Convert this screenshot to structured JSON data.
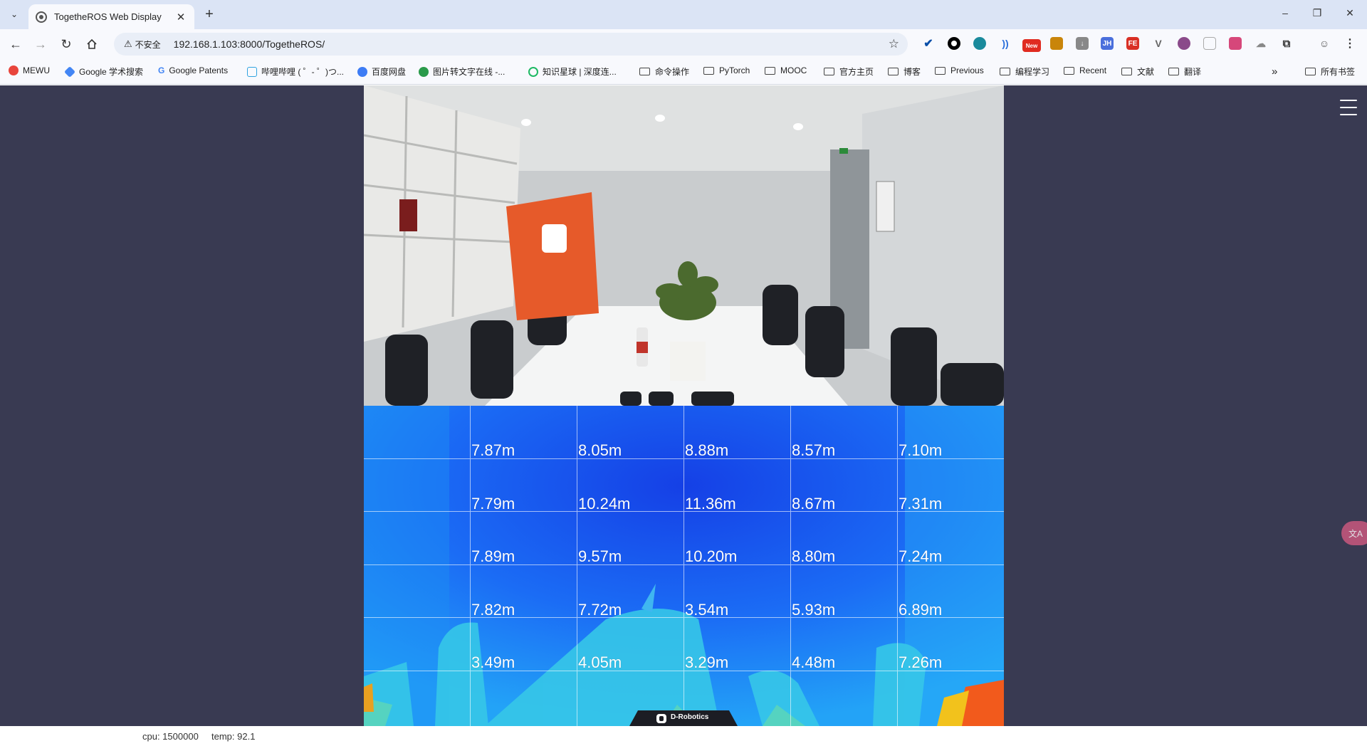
{
  "browser": {
    "tab_title": "TogetheROS Web Display",
    "security_label": "不安全",
    "url": "192.168.1.103:8000/TogetheROS/",
    "new_badge": "New",
    "ext_jh": "JH",
    "ext_fe": "FE"
  },
  "bookmarks": [
    {
      "label": "MEWU",
      "icon": "mewu-icon"
    },
    {
      "label": "Google 学术搜索",
      "icon": "scholar-icon"
    },
    {
      "label": "Google Patents",
      "icon": "google-icon"
    },
    {
      "label": "哔哩哔哩 ( ゜- ゜)つ...",
      "icon": "bilibili-icon"
    },
    {
      "label": "百度网盘",
      "icon": "baidu-icon"
    },
    {
      "label": "图片转文字在线 -...",
      "icon": "ocr-icon"
    },
    {
      "label": "知识星球 | 深度连...",
      "icon": "zsxq-icon"
    },
    {
      "label": "命令操作",
      "icon": "folder-icon"
    },
    {
      "label": "PyTorch",
      "icon": "folder-icon"
    },
    {
      "label": "MOOC",
      "icon": "folder-icon"
    },
    {
      "label": "官方主页",
      "icon": "folder-icon"
    },
    {
      "label": "博客",
      "icon": "folder-icon"
    },
    {
      "label": "Previous",
      "icon": "folder-icon"
    },
    {
      "label": "编程学习",
      "icon": "folder-icon"
    },
    {
      "label": "Recent",
      "icon": "folder-icon"
    },
    {
      "label": "文献",
      "icon": "folder-icon"
    },
    {
      "label": "翻译",
      "icon": "folder-icon"
    }
  ],
  "bookmarks_overflow": "»",
  "all_bookmarks": "所有书签",
  "depth_grid": [
    [
      "7.87m",
      "8.05m",
      "8.88m",
      "8.57m",
      "7.10m"
    ],
    [
      "7.79m",
      "10.24m",
      "11.36m",
      "8.67m",
      "7.31m"
    ],
    [
      "7.89m",
      "9.57m",
      "10.20m",
      "8.80m",
      "7.24m"
    ],
    [
      "7.82m",
      "7.72m",
      "3.54m",
      "5.93m",
      "6.89m"
    ],
    [
      "3.49m",
      "4.05m",
      "3.29m",
      "4.48m",
      "7.26m"
    ]
  ],
  "logo_text": "D-Robotics",
  "status": {
    "cpu": "cpu: 1500000",
    "temp": "temp: 92.1"
  },
  "translate_fab": "文A",
  "colors": {
    "page_bg": "#393a52",
    "tabstrip": "#dbe4f5",
    "toolbar": "#f8f9fd"
  }
}
